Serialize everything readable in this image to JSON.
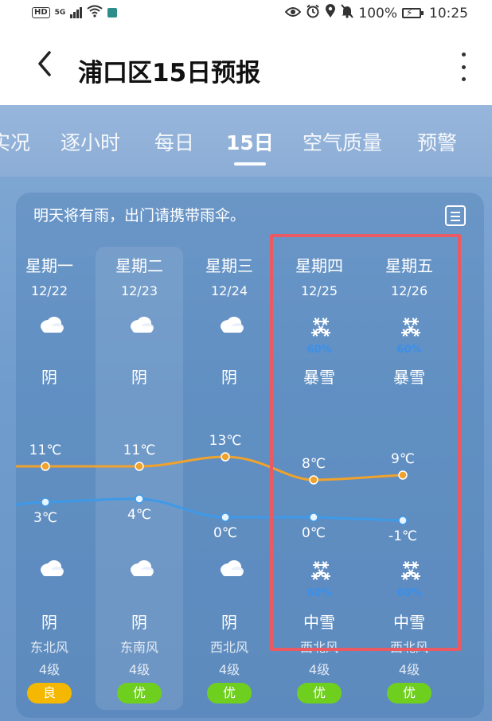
{
  "status_bar": {
    "network": "HD",
    "net_type": "5G",
    "battery": "100%",
    "time": "10:25"
  },
  "header": {
    "title": "浦口区15日预报"
  },
  "tabs": [
    {
      "label": "实况"
    },
    {
      "label": "逐小时"
    },
    {
      "label": "每日"
    },
    {
      "label": "15日",
      "active": true
    },
    {
      "label": "空气质量"
    },
    {
      "label": "预警"
    }
  ],
  "tip": "明天将有雨，出门请携带雨伞。",
  "colors": {
    "high_line": "#f0a22c",
    "low_line": "#3e9ae8",
    "aqi_good": "#f5b800",
    "aqi_excellent": "#6fcf1e",
    "highlight_border": "#ea5a62"
  },
  "days": [
    {
      "day": "星期一",
      "date": "12/22",
      "day_icon": "cloudy-icon",
      "day_prob": "",
      "day_cond": "阴",
      "high": "11℃",
      "low": "3℃",
      "night_icon": "cloudy-icon",
      "night_prob": "",
      "night_cond": "阴",
      "wind": "东北风",
      "level": "4级",
      "aqi": "良",
      "aqi_kind": "good"
    },
    {
      "day": "星期二",
      "date": "12/23",
      "day_icon": "cloudy-icon",
      "day_prob": "",
      "day_cond": "阴",
      "high": "11℃",
      "low": "4℃",
      "night_icon": "cloudy-icon",
      "night_prob": "",
      "night_cond": "阴",
      "wind": "东南风",
      "level": "4级",
      "aqi": "优",
      "aqi_kind": "excellent"
    },
    {
      "day": "星期三",
      "date": "12/24",
      "day_icon": "cloudy-icon",
      "day_prob": "",
      "day_cond": "阴",
      "high": "13℃",
      "low": "0℃",
      "night_icon": "cloudy-icon",
      "night_prob": "",
      "night_cond": "阴",
      "wind": "西北风",
      "level": "4级",
      "aqi": "优",
      "aqi_kind": "excellent"
    },
    {
      "day": "星期四",
      "date": "12/25",
      "day_icon": "snowflake-icon",
      "day_prob": "60%",
      "day_cond": "暴雪",
      "high": "8℃",
      "low": "0℃",
      "night_icon": "snowflake-icon",
      "night_prob": "60%",
      "night_cond": "中雪",
      "wind": "西北风",
      "level": "4级",
      "aqi": "优",
      "aqi_kind": "excellent"
    },
    {
      "day": "星期五",
      "date": "12/26",
      "day_icon": "snowflake-icon",
      "day_prob": "60%",
      "day_cond": "暴雪",
      "high": "9℃",
      "low": "-1℃",
      "night_icon": "snowflake-icon",
      "night_prob": "60%",
      "night_cond": "中雪",
      "wind": "西北风",
      "level": "4级",
      "aqi": "优",
      "aqi_kind": "excellent"
    }
  ]
}
